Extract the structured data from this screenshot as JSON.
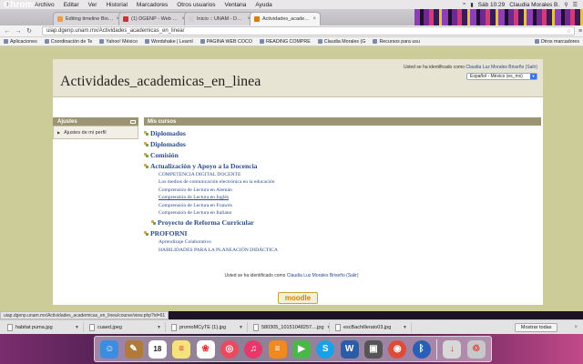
{
  "menubar": {
    "items": [
      "Chrome",
      "Archivo",
      "Editar",
      "Ver",
      "Historial",
      "Marcadores",
      "Otros usuarios",
      "Ventana",
      "Ayuda"
    ],
    "clock": "Sáb 10:29",
    "user": "Claudia Morales B."
  },
  "tabs": [
    {
      "title": "Editing timeline Biografía",
      "color": "#e8a040"
    },
    {
      "title": "(1) DGENP - Web Search",
      "color": "#cc3333"
    },
    {
      "title": "Inicio :: UNAM - DGENP",
      "color": "#d0d0d0"
    },
    {
      "title": "Actividades_academicos",
      "color": "#e07b00"
    }
  ],
  "toolbar": {
    "url": "uiap.dgenp.unam.mx/Actividades_academicas_en_linea/"
  },
  "bookmarks": {
    "items": [
      "Aplicaciones",
      "Coordinación de Te",
      "Yahoo! México",
      "Wordshake | Learnl",
      "PAGINA WEB COCO",
      "READING COMPRE",
      "Claudia Morales (G",
      "Recursos para usu"
    ],
    "other": "Otros marcadores"
  },
  "site": {
    "title": "Actividades_academicas_en_linea",
    "login_prefix": "Usted se ha identificado como",
    "user_name": "Claudia Luz Morales Briseño",
    "logout": "(Salir)",
    "language": "Español - México (es_mx)"
  },
  "settings_block": {
    "title": "Ajustes",
    "item": "Ajustes de mi perfil"
  },
  "courses": {
    "title": "Mis cursos",
    "categories": [
      {
        "name": "Diplomados"
      },
      {
        "name": "Diplomados"
      },
      {
        "name": "Comisión"
      },
      {
        "name": "Actualización y Apoyo a la Docencia",
        "courses": [
          "COMPETENCIA DIGITAL DOCENTE",
          "Los medios de comunicación electrónica en la educación",
          "Comprensión de Lectura en Alemán",
          "Comprensión de Lectura en Inglés",
          "Comprensión de Lectura en Francés",
          "Comprensión de Lectura en Italiano"
        ],
        "subcategory": "Proyecto de Reforma Curricular"
      },
      {
        "name": "PROFORNI",
        "courses": [
          "Aprendizaje Colaborativo",
          "HABILIDADES PARA LA PLANEACIÓN DIDÁCTICA"
        ]
      }
    ]
  },
  "footer": {
    "login_prefix": "Usted se ha identificado como",
    "user_name": "Claudia Luz Morales Briseño",
    "logout": "(Salir)",
    "logo": "moodle"
  },
  "status_url": "uiap.dgenp.unam.mx/Actividades_academicas_en_linea/course/view.php?id=61",
  "downloads": {
    "items": [
      "habitat puma.jpg",
      "cuaed.jpeg",
      "promoMCyTE (1).jpg",
      "580305_10151048257....jpg",
      "escBachillerato03.jpg"
    ],
    "show_all": "Mostrar todas"
  },
  "dock": {
    "apps": [
      {
        "icon": "finder-icon",
        "color": "#3a8de0",
        "glyph": "☺"
      },
      {
        "icon": "notes-icon",
        "color": "#b07a3a",
        "glyph": "✎"
      },
      {
        "icon": "calendar-icon",
        "color": "#ffffff",
        "glyph": "18"
      },
      {
        "icon": "stickies-icon",
        "color": "#f5e27a",
        "glyph": "≡"
      },
      {
        "icon": "photos-icon",
        "color": "#ffffff",
        "glyph": "❀"
      },
      {
        "icon": "photo-app-icon",
        "color": "#e84a5f",
        "glyph": "◎"
      },
      {
        "icon": "itunes-icon",
        "color": "#e8386a",
        "glyph": "♫"
      },
      {
        "icon": "ibooks-icon",
        "color": "#f08a1e",
        "glyph": "≡"
      },
      {
        "icon": "facetime-icon",
        "color": "#4ab848",
        "glyph": "▶"
      },
      {
        "icon": "skype-icon",
        "color": "#1aa0e8",
        "glyph": "S"
      },
      {
        "icon": "word-icon",
        "color": "#2b5ca8",
        "glyph": "W"
      },
      {
        "icon": "photobooth-icon",
        "color": "#555555",
        "glyph": "▣"
      },
      {
        "icon": "chrome-icon",
        "color": "#dd4b39",
        "glyph": "◉"
      },
      {
        "icon": "bluetooth-icon",
        "color": "#2a5fb8",
        "glyph": "ᛒ"
      },
      {
        "icon": "downloads-folder-icon",
        "color": "#d8d8d8",
        "glyph": "↓"
      },
      {
        "icon": "trash-icon",
        "color": "#c8c8c8",
        "glyph": "♲"
      }
    ]
  }
}
